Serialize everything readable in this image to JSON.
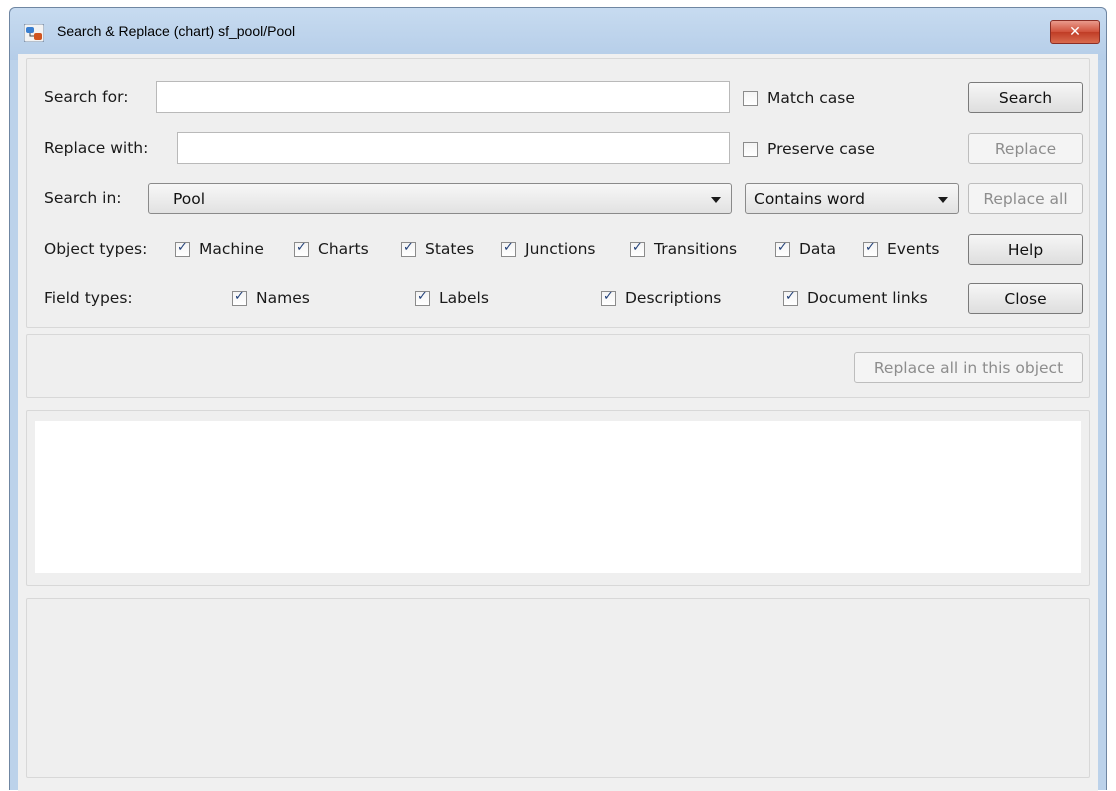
{
  "window": {
    "title": "Search & Replace (chart) sf_pool/Pool",
    "close_glyph": "✕"
  },
  "search": {
    "search_for_label": "Search for:",
    "search_for_value": "",
    "replace_with_label": "Replace with:",
    "replace_with_value": "",
    "search_in_label": "Search in:",
    "search_in_value": "Pool",
    "match_mode_value": "Contains word"
  },
  "options": {
    "match_case": {
      "label": "Match case",
      "checked": false
    },
    "preserve_case": {
      "label": "Preserve case",
      "checked": false
    }
  },
  "object_types": {
    "label": "Object types:",
    "items": [
      {
        "label": "Machine",
        "checked": true
      },
      {
        "label": "Charts",
        "checked": true
      },
      {
        "label": "States",
        "checked": true
      },
      {
        "label": "Junctions",
        "checked": true
      },
      {
        "label": "Transitions",
        "checked": true
      },
      {
        "label": "Data",
        "checked": true
      },
      {
        "label": "Events",
        "checked": true
      }
    ]
  },
  "field_types": {
    "label": "Field types:",
    "items": [
      {
        "label": "Names",
        "checked": true
      },
      {
        "label": "Labels",
        "checked": true
      },
      {
        "label": "Descriptions",
        "checked": true
      },
      {
        "label": "Document links",
        "checked": true
      }
    ]
  },
  "buttons": {
    "search": "Search",
    "replace": "Replace",
    "replace_all": "Replace all",
    "help": "Help",
    "close": "Close",
    "replace_all_in_object": "Replace all in this object"
  },
  "icons": {
    "app": "stateflow-chart-icon",
    "close": "close-icon",
    "dropdown": "chevron-down-icon"
  }
}
